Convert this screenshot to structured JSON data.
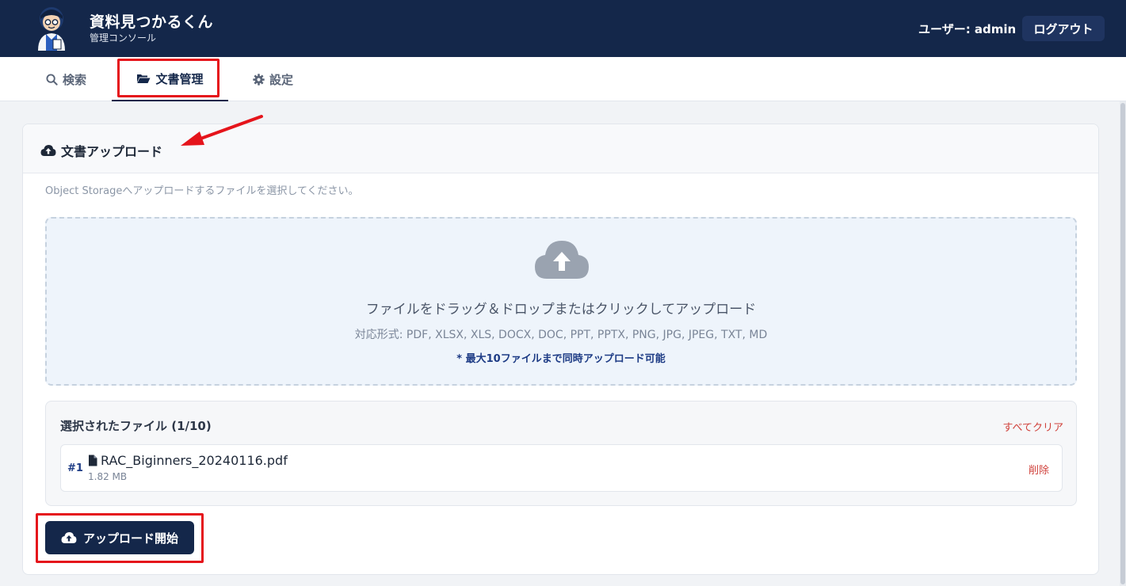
{
  "header": {
    "app_title": "資料見つかるくん",
    "app_subtitle": "管理コンソール",
    "user_label": "ユーザー: admin",
    "logout_label": "ログアウト"
  },
  "tabs": [
    {
      "label": "検索",
      "icon": "search-icon"
    },
    {
      "label": "文書管理",
      "icon": "folder-open-icon",
      "active": true
    },
    {
      "label": "設定",
      "icon": "gear-icon"
    }
  ],
  "upload_card": {
    "title": "文書アップロード",
    "description": "Object Storageへアップロードするファイルを選択してください。",
    "dropzone": {
      "main_text": "ファイルをドラッグ＆ドロップまたはクリックしてアップロード",
      "formats": "対応形式: PDF, XLSX, XLS, DOCX, DOC, PPT, PPTX, PNG, JPG, JPEG, TXT, MD",
      "limit_note": "* 最大10ファイルまで同時アップロード可能"
    },
    "selected_files": {
      "title": "選択されたファイル (1/10)",
      "clear_all_label": "すべてクリア",
      "files": [
        {
          "index": "#1",
          "name": "RAC_Biginners_20240116.pdf",
          "size": "1.82 MB",
          "delete_label": "削除"
        }
      ]
    },
    "upload_button_label": "アップロード開始"
  },
  "colors": {
    "header_bg": "#14274a",
    "accent": "#14274a",
    "danger": "#d0413b",
    "annotation": "#e5141b"
  }
}
